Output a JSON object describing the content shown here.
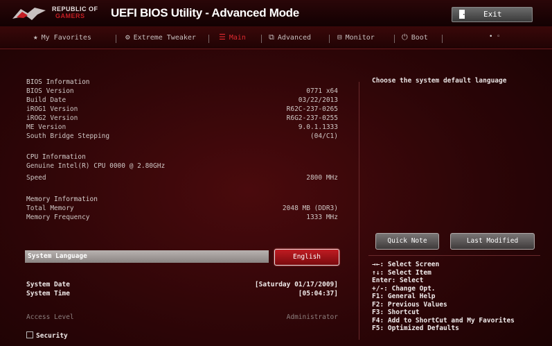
{
  "title_bar": {
    "brand_top": "REPUBLIC OF",
    "brand_bottom": "GAMERS",
    "app_title": "UEFI BIOS Utility - Advanced Mode",
    "exit_label": "Exit"
  },
  "tabs": [
    {
      "label": "My Favorites",
      "icon": "star-icon"
    },
    {
      "label": "Extreme Tweaker",
      "icon": "tweaker-icon"
    },
    {
      "label": "Main",
      "icon": "list-icon",
      "active": true
    },
    {
      "label": "Advanced",
      "icon": "advanced-icon"
    },
    {
      "label": "Monitor",
      "icon": "monitor-icon"
    },
    {
      "label": "Boot",
      "icon": "power-icon"
    }
  ],
  "pager": "• ◦",
  "bios_info": {
    "heading": "BIOS Information",
    "rows": [
      {
        "label": "BIOS Version",
        "value": "0771 x64"
      },
      {
        "label": "Build Date",
        "value": "03/22/2013"
      },
      {
        "label": "iROG1 Version",
        "value": "R62C-237-0265"
      },
      {
        "label": "iROG2 Version",
        "value": "R6G2-237-0255"
      },
      {
        "label": "ME Version",
        "value": "9.0.1.1333"
      },
      {
        "label": "South Bridge Stepping",
        "value": "(04/C1)"
      }
    ]
  },
  "cpu_info": {
    "heading": "CPU Information",
    "model": "Genuine Intel(R) CPU 0000 @ 2.80GHz",
    "speed_label": "Speed",
    "speed_value": "2800 MHz"
  },
  "memory_info": {
    "heading": "Memory Information",
    "total_label": "Total Memory",
    "total_value": "2048 MB (DDR3)",
    "freq_label": "Memory Frequency",
    "freq_value": "1333 MHz"
  },
  "system_language": {
    "label": "System Language",
    "value": "English"
  },
  "system_date": {
    "label": "System Date",
    "value": "[Saturday 01/17/2009]"
  },
  "system_time": {
    "label": "System Time",
    "value": "[05:04:37]"
  },
  "access_level": {
    "label": "Access Level",
    "value": "Administrator"
  },
  "security_label": "Security",
  "help_text": "Choose the system default language",
  "quick_note_label": "Quick Note",
  "last_modified_label": "Last Modified",
  "key_help": [
    "→←: Select Screen",
    "↑↓: Select Item",
    "Enter: Select",
    "+/-: Change Opt.",
    "F1: General Help",
    "F2: Previous Values",
    "F3: Shortcut",
    "F4: Add to ShortCut and My Favorites",
    "F5: Optimized Defaults"
  ],
  "colors": {
    "accent": "#e02a30",
    "background": "#2c0507"
  }
}
